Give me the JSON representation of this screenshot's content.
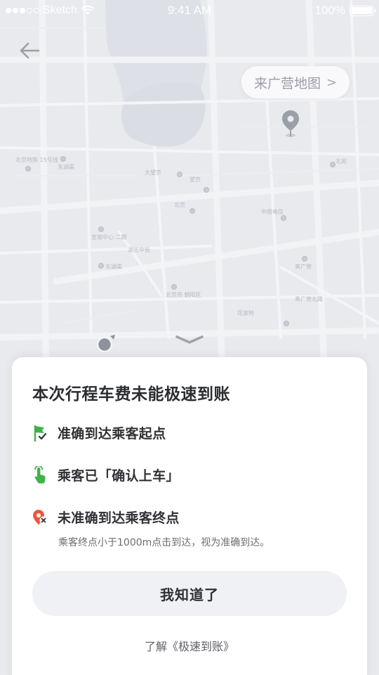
{
  "status_bar": {
    "carrier": "Sketch",
    "time": "9:41 AM",
    "battery": "100%",
    "battery_level": 1.0
  },
  "map": {
    "link_label": "来广营地图",
    "link_chevron": ">",
    "labels": [
      "北京地铁 15号线",
      "东湖渠",
      "宣南中心·二期",
      "北京市 朝阳区",
      "望京",
      "中国电信",
      "来广营",
      "北苑",
      "东湖渠",
      "花家地",
      "大望京",
      "北京",
      "湖光中街",
      "来广营北路"
    ]
  },
  "dialog": {
    "title": "本次行程车费未能极速到账",
    "conditions": [
      {
        "text": "准确到达乘客起点",
        "icon": "flag-check-icon",
        "color": "#3fb24a"
      },
      {
        "text": "乘客已「确认上车」",
        "icon": "hand-tap-icon",
        "color": "#3fb24a"
      },
      {
        "text": "未准确到达乘客终点",
        "icon": "pin-error-icon",
        "color": "#f0553d"
      }
    ],
    "note": "乘客终点小于1000m点击到达，视为准确到达。",
    "button_label": "我知道了",
    "link_label": "了解《极速到账》"
  }
}
